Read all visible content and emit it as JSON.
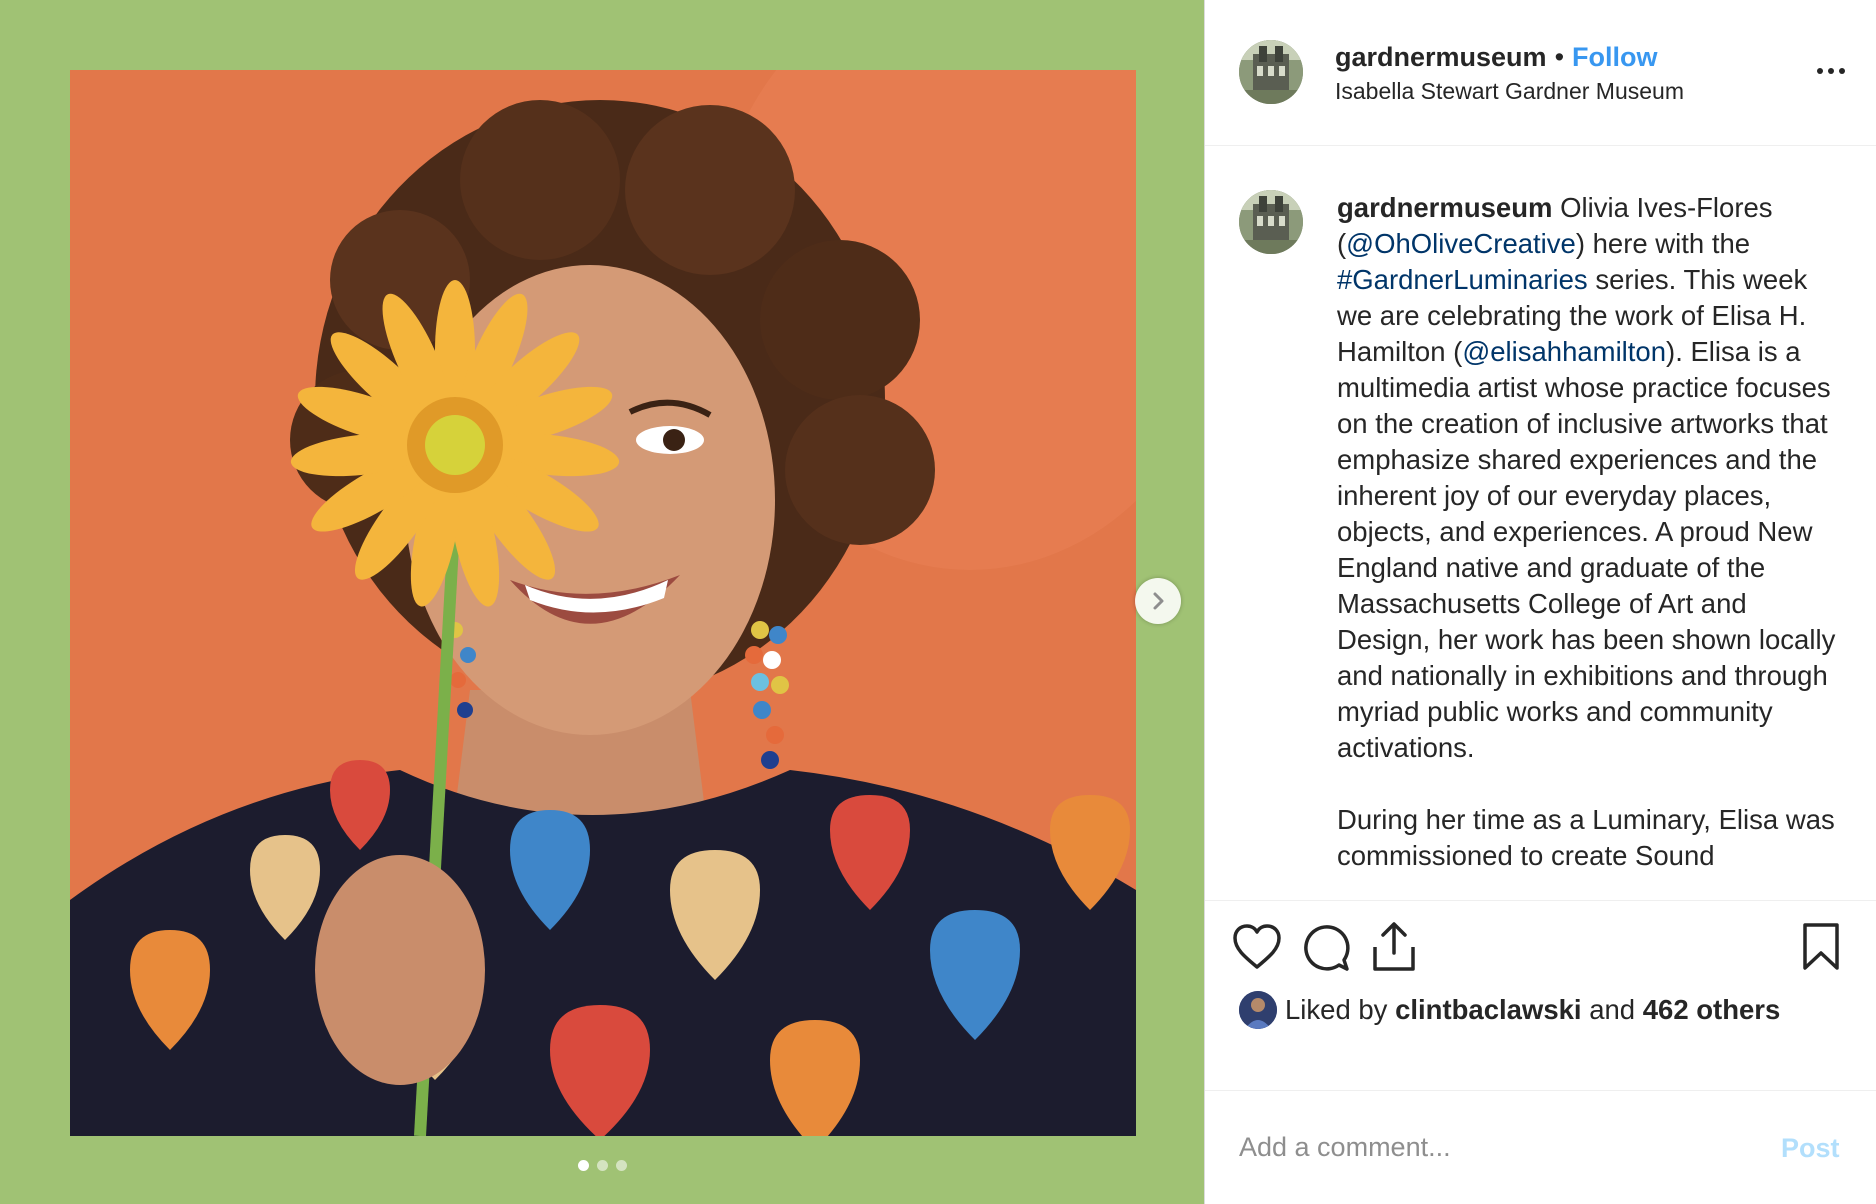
{
  "post": {
    "username": "gardnermuseum",
    "separator": "•",
    "follow_label": "Follow",
    "location": "Isabella Stewart Gardner Museum",
    "more_icon": "ellipsis-icon",
    "slides_total": 3,
    "slide_active": 1
  },
  "caption": {
    "username": "gardnermuseum",
    "t1": " Olivia Ives-Flores (",
    "mention1": "@OhOliveCreative",
    "t2": ") here with the ",
    "hashtag": "#GardnerLuminaries",
    "t3": " series. This week we are celebrating the work of Elisa H. Hamilton (",
    "mention2": "@elisahhamilton",
    "t4": "). Elisa is a multimedia artist whose practice focuses on the creation of inclusive artworks that emphasize shared experiences and the inherent joy of our everyday places, objects, and experiences. A proud New England native and graduate of the Massachusetts College of Art and Design, her work has been shown locally and nationally in exhibitions and through myriad public works and community activations.",
    "p2": "During her time as a Luminary, Elisa was commissioned to create Sound"
  },
  "actions": {
    "like_icon": "heart-icon",
    "comment_icon": "comment-bubble-icon",
    "share_icon": "share-upload-icon",
    "save_icon": "bookmark-icon"
  },
  "likes": {
    "prefix": "Liked by",
    "user": "clintbaclawski",
    "and": "and",
    "count": "462 others"
  },
  "comment": {
    "placeholder": "Add a comment...",
    "post_label": "Post"
  },
  "colors": {
    "media_border": "#a0c274",
    "backdrop": "#e2774a",
    "link": "#003569",
    "follow": "#3897f0",
    "post_disabled": "#b2dffc"
  }
}
